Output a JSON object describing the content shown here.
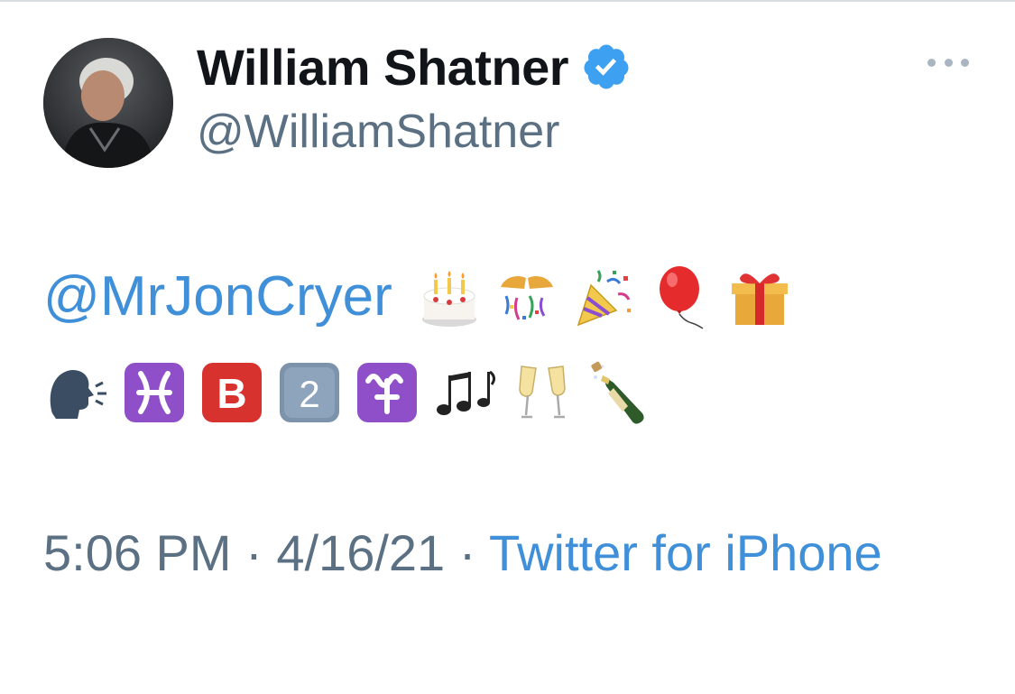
{
  "user": {
    "display_name": "William Shatner",
    "handle": "@WilliamShatner",
    "verified": true
  },
  "tweet": {
    "mention": "@MrJonCryer",
    "emojis_line1": [
      "birthday-cake",
      "confetti-ball",
      "party-popper",
      "balloon",
      "wrapped-gift"
    ],
    "emojis_line2": [
      "speaking-head",
      "pisces",
      "b-button",
      "keycap-2",
      "ophiuchus",
      "musical-notes",
      "clinking-glasses",
      "bottle-with-popping-cork"
    ]
  },
  "meta": {
    "time": "5:06 PM",
    "separator": "·",
    "date": "4/16/21",
    "source": "Twitter for iPhone"
  },
  "colors": {
    "link": "#3f8fd9",
    "secondary": "#5b7083",
    "verified": "#1d9bf0"
  }
}
